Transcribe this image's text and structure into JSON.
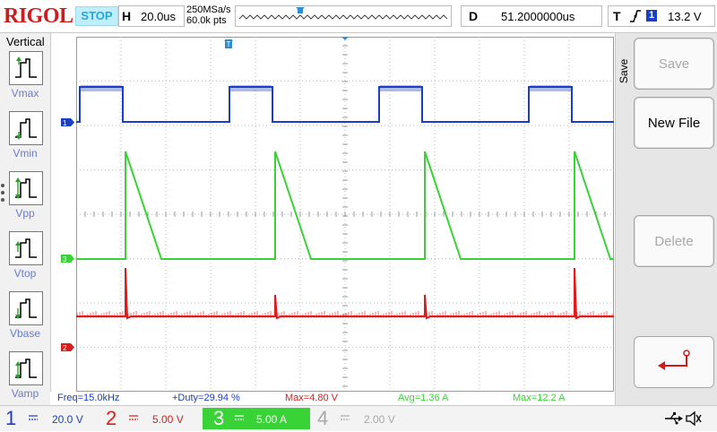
{
  "header": {
    "brand": "RIGOL",
    "run_state": "STOP",
    "timebase_label": "H",
    "timebase_value": "20.0us",
    "sample_rate": "250MSa/s",
    "memory_depth": "60.0k pts",
    "delay_label": "D",
    "delay_value": "51.2000000us",
    "trigger_label": "T",
    "trigger_source": "1",
    "trigger_level": "13.2 V"
  },
  "left_panel": {
    "title": "Vertical",
    "measurements": [
      "Vmax",
      "Vmin",
      "Vpp",
      "Vtop",
      "Vbase",
      "Vamp"
    ]
  },
  "right_panel": {
    "menu_title": "Save",
    "buttons": [
      {
        "label": "Save",
        "enabled": false
      },
      {
        "label": "New File",
        "enabled": true
      },
      {
        "label": "Delete",
        "enabled": false
      }
    ],
    "return_icon": "return-arrow-icon"
  },
  "measurement_bar": {
    "freq": "Freq=15.0kHz",
    "duty": "+Duty=29.94 %",
    "max_ch2": "Max=4.80 V",
    "avg_ch3": "Avg=1.36 A",
    "max_ch3": "Max=12.2 A"
  },
  "channels": [
    {
      "number": "1",
      "scale": "20.0 V",
      "color": "#1a3ec6",
      "active": false
    },
    {
      "number": "2",
      "scale": "5.00 V",
      "color": "#e01b1b",
      "active": false
    },
    {
      "number": "3",
      "scale": "5.00 A",
      "color": "#3ad337",
      "active": true
    },
    {
      "number": "4",
      "scale": "2.00 V",
      "color": "#a8a8a8",
      "active": false
    }
  ],
  "colors": {
    "ch1": "#1a3ec6",
    "ch2": "#e01b1b",
    "ch3": "#3ad337",
    "ch4": "#a8a8a8",
    "brand": "#d11a1a",
    "stop": "#27a6dc"
  },
  "status_icons": [
    "usb-icon",
    "speaker-icon"
  ]
}
